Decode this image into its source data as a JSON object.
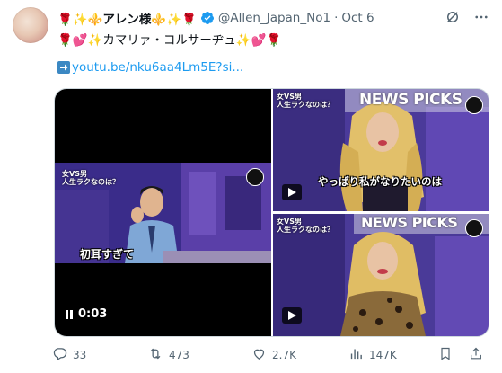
{
  "tweet": {
    "display_name": "🌹✨⚜️アレン様⚜️✨🌹",
    "handle": "@Allen_Japan_No1",
    "separator": "·",
    "date": "Oct 6",
    "second_line": "🌹💕✨カマリァ・コルサーヂュ✨💕🌹",
    "link_text": "youtu.be/nku6aa4Lm5E?si...",
    "verified_color": "#1d9bf0"
  },
  "media": {
    "video_left": {
      "time": "0:03",
      "tag_line1": "女VS男",
      "tag_line2": "人生ラクなのは？",
      "subtitle": "初耳すぎて"
    },
    "image_top_right": {
      "brand": "NEWS PICKS",
      "tag_line1": "女VS男",
      "tag_line2": "人生ラクなのは？",
      "subtitle": "やっぱり私がなりたいのは"
    },
    "image_bottom_right": {
      "brand": "NEWS PICKS",
      "tag_line1": "女VS男",
      "tag_line2": "人生ラクなのは？"
    }
  },
  "actions": {
    "replies": "33",
    "reposts": "473",
    "likes": "2.7K",
    "views": "147K"
  },
  "icons": [
    "grok-icon",
    "more-icon",
    "verified-icon",
    "reply-icon",
    "repost-icon",
    "like-icon",
    "views-icon",
    "bookmark-icon",
    "share-icon",
    "link-arrow-icon",
    "pause-icon",
    "play-icon"
  ]
}
